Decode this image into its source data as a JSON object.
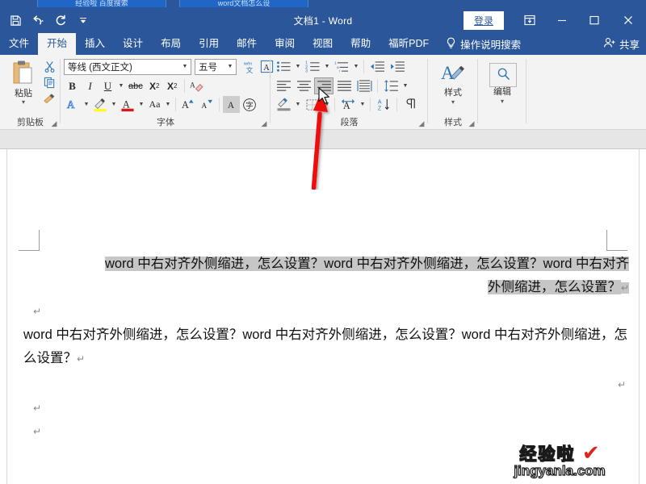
{
  "browser_tabs": [
    {
      "label": "经验啦 百度搜索"
    },
    {
      "label": "word文档怎么设"
    }
  ],
  "titlebar": {
    "document_title": "文档1  -  Word",
    "quick_access": [
      {
        "name": "save",
        "label": "保存"
      },
      {
        "name": "undo",
        "label": "撤消"
      },
      {
        "name": "redo",
        "label": "恢复"
      },
      {
        "name": "customize",
        "label": "自定义快速访问工具栏"
      }
    ],
    "signin_label": "登录",
    "window_buttons": [
      {
        "name": "ribbon-display-options",
        "glyph": "▣"
      },
      {
        "name": "minimize",
        "glyph": "—"
      },
      {
        "name": "maximize",
        "glyph": "☐"
      },
      {
        "name": "close",
        "glyph": "✕"
      }
    ]
  },
  "ribbon_tabs": [
    {
      "label": "文件",
      "active": false
    },
    {
      "label": "开始",
      "active": true
    },
    {
      "label": "插入",
      "active": false
    },
    {
      "label": "设计",
      "active": false
    },
    {
      "label": "布局",
      "active": false
    },
    {
      "label": "引用",
      "active": false
    },
    {
      "label": "邮件",
      "active": false
    },
    {
      "label": "审阅",
      "active": false
    },
    {
      "label": "视图",
      "active": false
    },
    {
      "label": "帮助",
      "active": false
    },
    {
      "label": "福昕PDF",
      "active": false
    }
  ],
  "tell_me": {
    "label": "操作说明搜索"
  },
  "share": {
    "label": "共享"
  },
  "groups": {
    "clipboard": {
      "label": "剪贴板",
      "paste_label": "粘贴",
      "items": [
        {
          "name": "cut",
          "label": "剪切"
        },
        {
          "name": "copy",
          "label": "复制"
        },
        {
          "name": "format-painter",
          "label": "格式刷"
        }
      ]
    },
    "font": {
      "label": "字体",
      "font_name": "等线 (西文正文)",
      "font_size": "五号",
      "buttons": [
        {
          "name": "phonetic-guide",
          "label": "拼音指南"
        },
        {
          "name": "character-border",
          "label": "字符边框"
        },
        {
          "name": "bold",
          "label": "B"
        },
        {
          "name": "italic",
          "label": "I"
        },
        {
          "name": "underline",
          "label": "U"
        },
        {
          "name": "strikethrough",
          "label": "abc"
        },
        {
          "name": "subscript",
          "label": "X₂"
        },
        {
          "name": "superscript",
          "label": "X²"
        },
        {
          "name": "clear-formatting",
          "label": "清除所有格式"
        },
        {
          "name": "text-effects",
          "label": "文本效果和版式"
        },
        {
          "name": "text-highlight-color",
          "label": "文本突出显示颜色"
        },
        {
          "name": "font-color",
          "label": "字体颜色"
        },
        {
          "name": "change-case",
          "label": "Aa"
        },
        {
          "name": "grow-font",
          "label": "增大字号"
        },
        {
          "name": "shrink-font",
          "label": "减小字号"
        },
        {
          "name": "character-shading",
          "label": "字符底纹"
        },
        {
          "name": "enclose-characters",
          "label": "带圈字符"
        }
      ]
    },
    "paragraph": {
      "label": "段落",
      "buttons": [
        {
          "name": "bullets",
          "label": "项目符号"
        },
        {
          "name": "numbering",
          "label": "编号"
        },
        {
          "name": "multilevel-list",
          "label": "多级列表"
        },
        {
          "name": "decrease-indent",
          "label": "减少缩进量"
        },
        {
          "name": "increase-indent",
          "label": "增加缩进量"
        },
        {
          "name": "align-left",
          "label": "左对齐",
          "selected": false
        },
        {
          "name": "align-center",
          "label": "居中",
          "selected": false
        },
        {
          "name": "align-right",
          "label": "右对齐",
          "selected": true
        },
        {
          "name": "justify",
          "label": "两端对齐",
          "selected": false
        },
        {
          "name": "distribute",
          "label": "分散对齐",
          "selected": false
        },
        {
          "name": "line-spacing",
          "label": "行和段落间距"
        },
        {
          "name": "shading",
          "label": "底纹"
        },
        {
          "name": "borders",
          "label": "边框"
        },
        {
          "name": "asian-layout",
          "label": "中文版式"
        },
        {
          "name": "sort",
          "label": "排序"
        },
        {
          "name": "show-formatting-marks",
          "label": "显示/隐藏编辑标记"
        }
      ]
    },
    "styles": {
      "label": "样式",
      "button_label": "样式"
    },
    "editing": {
      "label": "编辑",
      "button_label": "编辑"
    }
  },
  "document": {
    "paragraph1": {
      "line1": "word 中右对齐外侧缩进，怎么设置？word 中右对齐外侧缩进，怎么设置？word 中右对齐",
      "line2": "外侧缩进，怎么设置？",
      "para_mark": "↵",
      "selected": true,
      "alignment": "right"
    },
    "empty1": {
      "para_mark": "↵"
    },
    "paragraph2": {
      "text": "word 中右对齐外侧缩进，怎么设置？word 中右对齐外侧缩进，怎么设置？word 中右对齐外侧缩进，怎么设置？",
      "para_mark": "↵",
      "selected": false,
      "alignment": "left"
    },
    "empty2": {
      "para_mark": "↵"
    },
    "empty3": {
      "para_mark": "↵"
    },
    "right_mark": {
      "para_mark": "↵"
    }
  },
  "annotation": {
    "arrow": {
      "name": "red-arrow-pointer",
      "color": "#ee1111",
      "points_to": "align-right"
    }
  },
  "watermark": {
    "line1": "经验啦",
    "check": "✔",
    "line2": "jingyanla.com"
  },
  "colors": {
    "titlebar": "#2b579a",
    "ribbon_bg": "#f3f3f3",
    "selection": "#c6c6c6",
    "accent_red": "#ee1111",
    "highlight_yellow": "#ffff00",
    "font_color_red": "#d41b1b"
  }
}
